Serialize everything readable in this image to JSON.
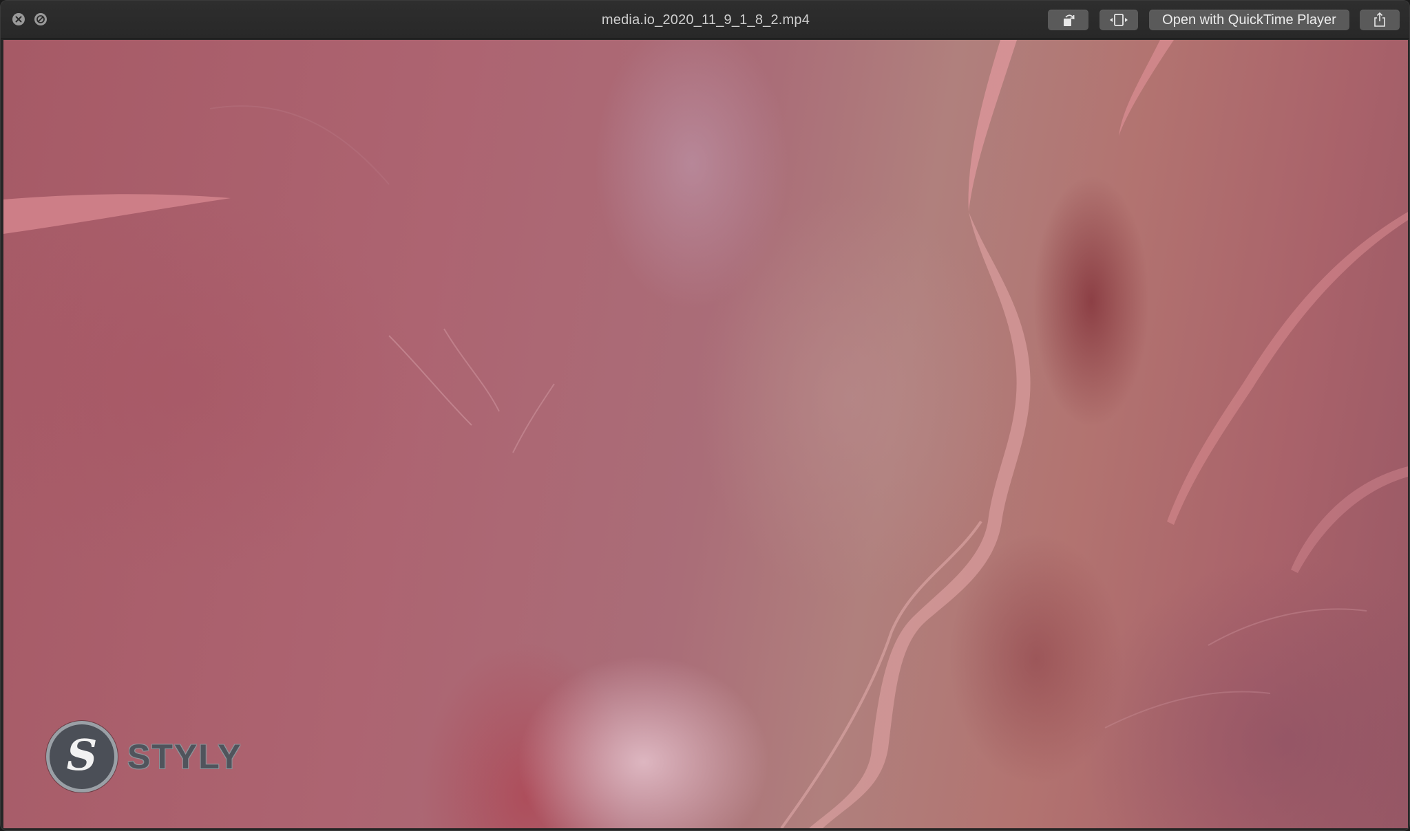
{
  "window": {
    "title": "media.io_2020_11_9_1_8_2.mp4",
    "controls": {
      "close_icon": "close-x-icon",
      "block_icon": "no-entry-icon"
    }
  },
  "toolbar": {
    "rotate_icon": "rotate-left-icon",
    "fit_icon": "trim-icon",
    "open_label": "Open with QuickTime Player",
    "share_icon": "share-icon"
  },
  "video": {
    "logo": {
      "badge_letter": "S",
      "wordmark": "STYLY"
    }
  },
  "colors": {
    "titlebar": "#2b2b2b",
    "button": "#5a5a5a",
    "title_text": "#cfcfcf",
    "video_base": "#aa6470",
    "logo_dark": "#4b4f57",
    "logo_ring": "#9aa0a6"
  }
}
